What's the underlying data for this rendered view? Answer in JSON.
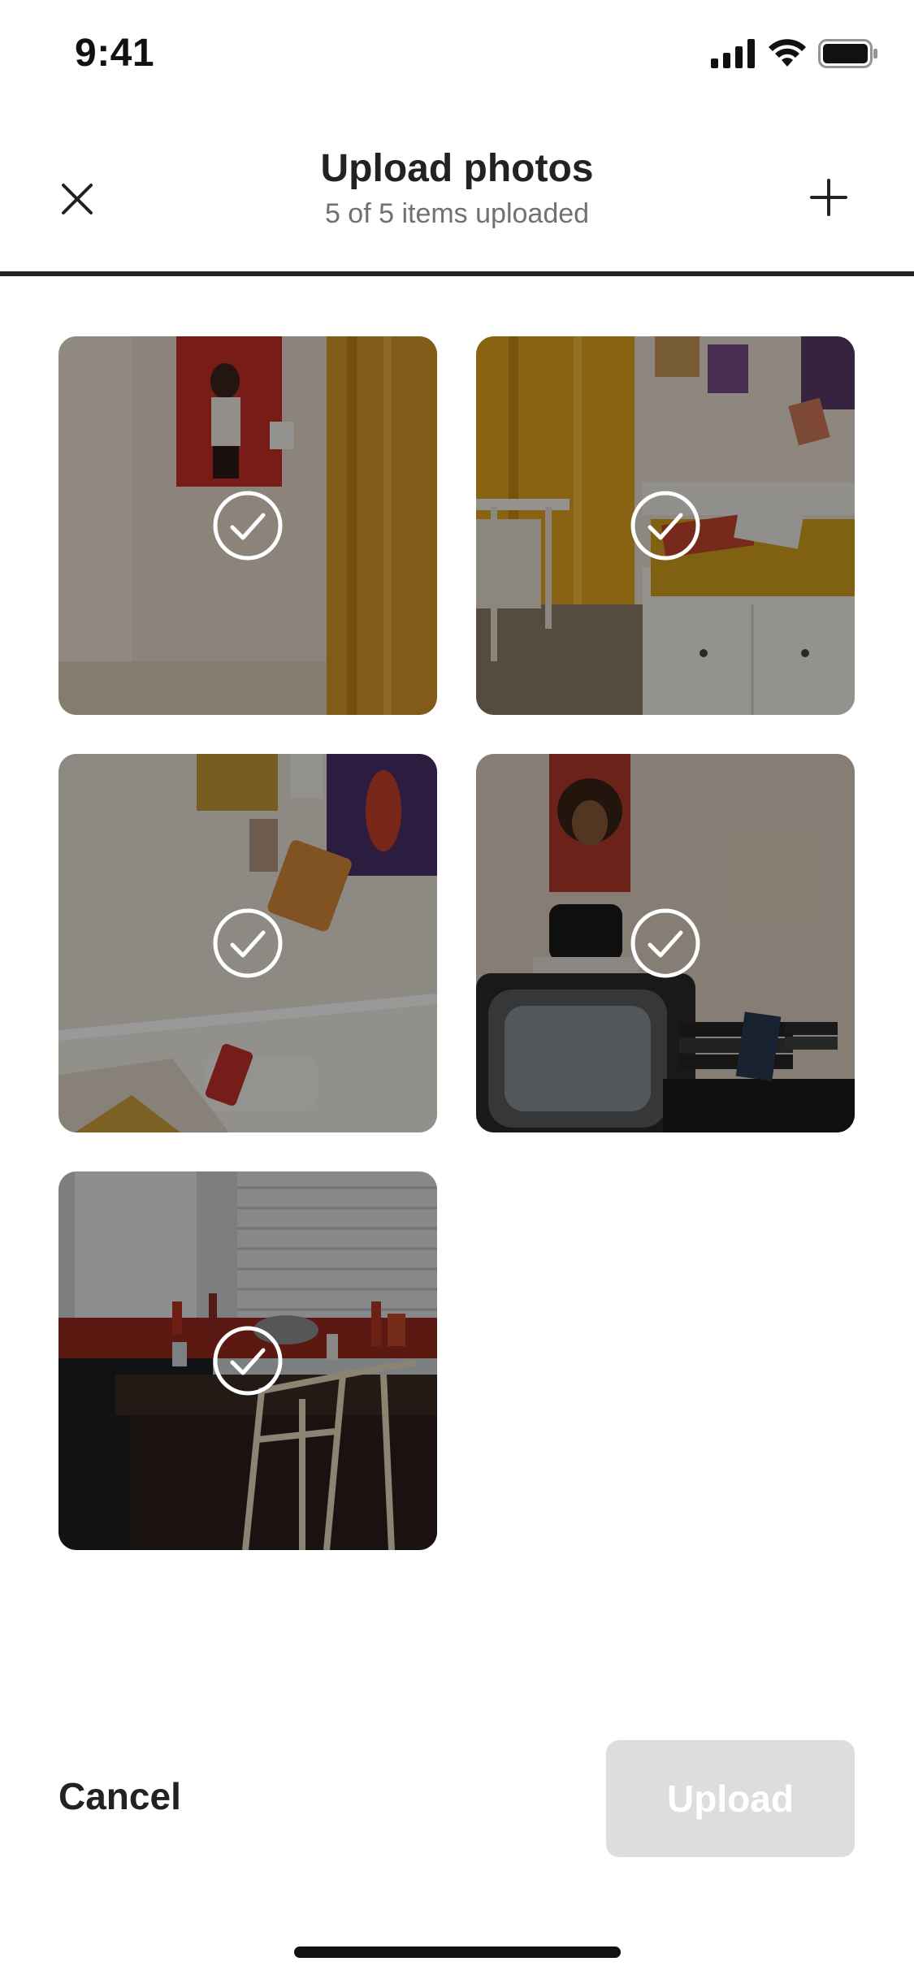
{
  "status_bar": {
    "time": "9:41",
    "icons": [
      "cellular-signal-icon",
      "wifi-icon",
      "battery-icon"
    ]
  },
  "header": {
    "title": "Upload photos",
    "subtitle": "5 of 5 items uploaded",
    "close_icon": "close-icon",
    "add_icon": "plus-icon",
    "progress": 1.0
  },
  "photos": [
    {
      "subject": "bedroom corner with poster and yellow curtain",
      "status": "uploaded",
      "status_icon": "check-circle-icon"
    },
    {
      "subject": "bedroom with daybed and desk",
      "status": "uploaded",
      "status_icon": "check-circle-icon"
    },
    {
      "subject": "wall with posters above daybed",
      "status": "uploaded",
      "status_icon": "check-circle-icon"
    },
    {
      "subject": "vintage tv and video tapes",
      "status": "uploaded",
      "status_icon": "check-circle-icon"
    },
    {
      "subject": "kitchen table with bottles and folding chairs",
      "status": "uploaded",
      "status_icon": "check-circle-icon"
    }
  ],
  "footer": {
    "cancel_label": "Cancel",
    "upload_label": "Upload",
    "upload_enabled": false
  },
  "colors": {
    "text_primary": "#222222",
    "text_secondary": "#717171",
    "progress": "#222222",
    "upload_disabled_bg": "#dddddd"
  }
}
